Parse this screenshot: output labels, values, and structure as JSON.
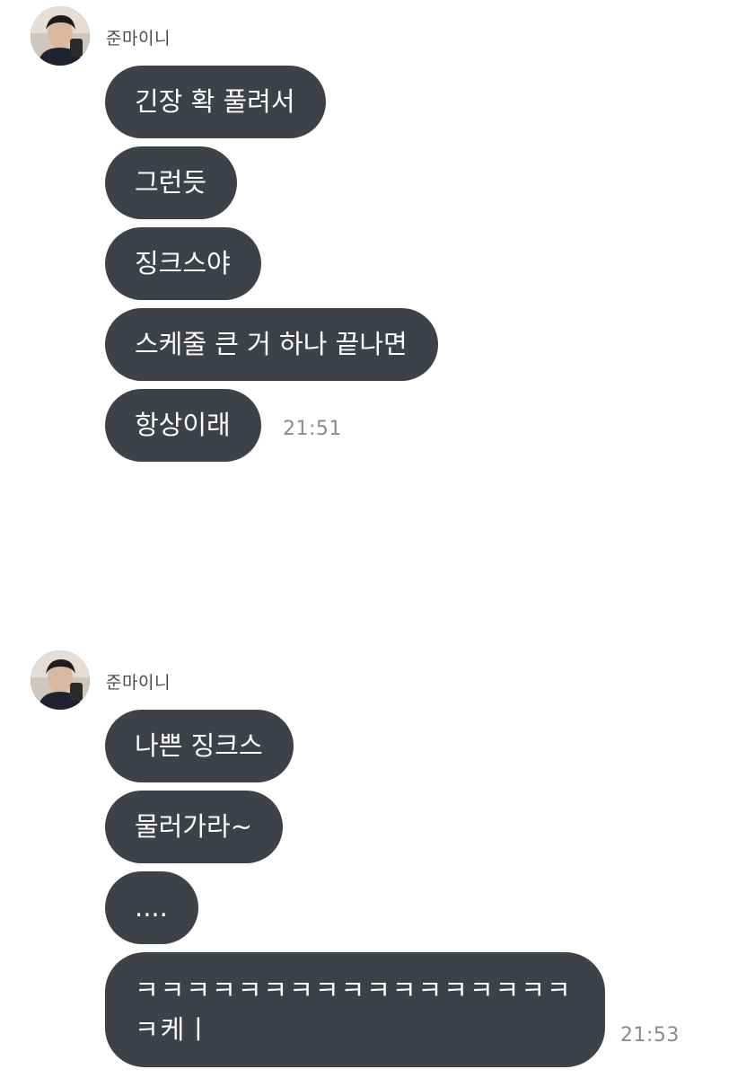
{
  "groups": [
    {
      "sender": "준마이니",
      "messages": [
        "긴장 확 풀려서",
        "그런듯",
        "징크스야",
        "스케줄 큰 거 하나 끝나면",
        "항상이래"
      ],
      "time": "21:51"
    },
    {
      "sender": "준마이니",
      "messages": [
        "나쁜 징크스",
        "물러가라~",
        "....",
        "ㅋㅋㅋㅋㅋㅋㅋㅋㅋㅋㅋㅋㅋㅋㅋㅋㅋㅋ케ㅣ"
      ],
      "time": "21:53"
    }
  ],
  "colors": {
    "bubble": "#3f4148",
    "bubble_text": "#ffffff",
    "sender_text": "#4a4a4a",
    "time_text": "#8b8b8b"
  }
}
